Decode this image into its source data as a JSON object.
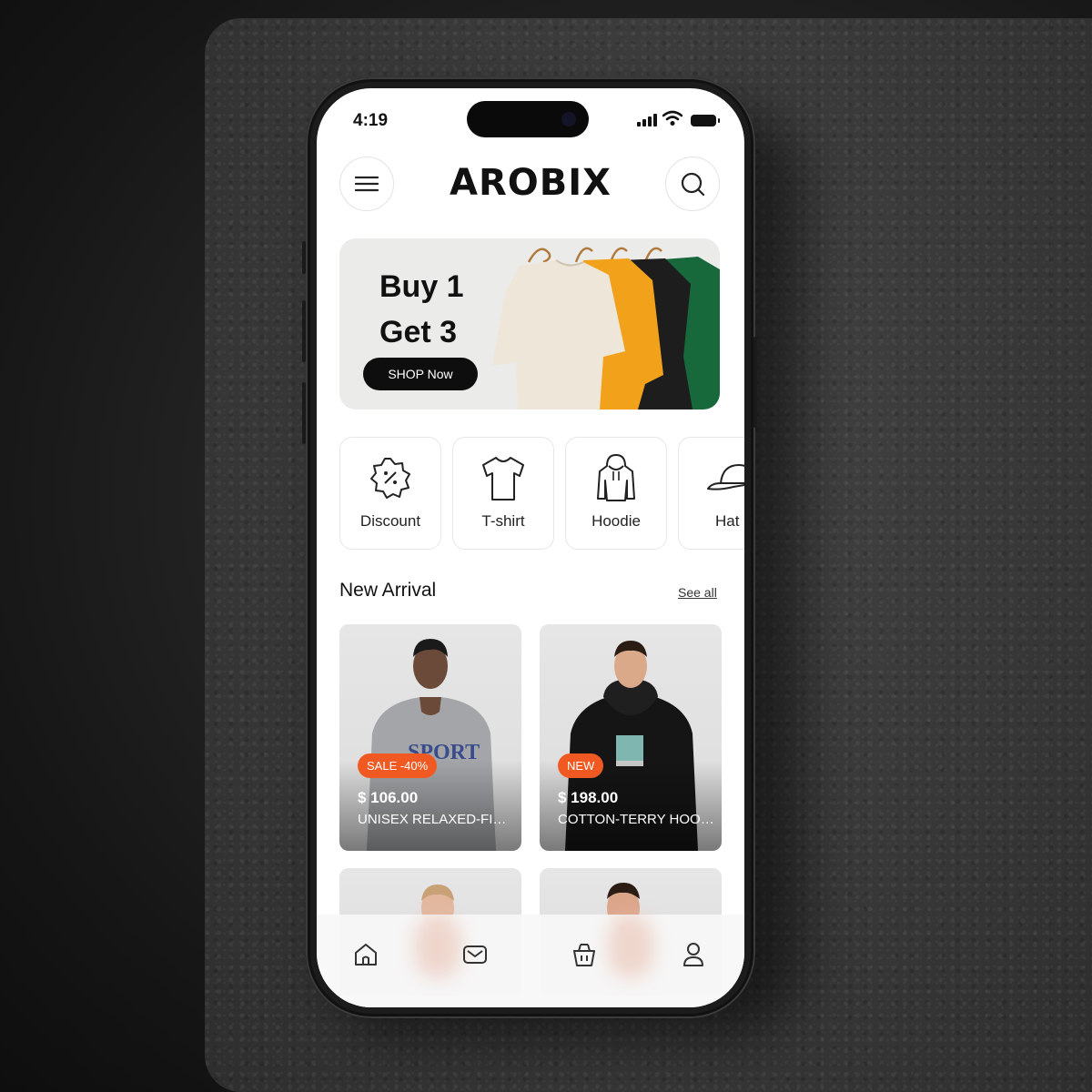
{
  "status_bar": {
    "time": "4:19"
  },
  "header": {
    "brand": "AROBIX",
    "menu_icon": "hamburger-menu-icon",
    "search_icon": "search-icon"
  },
  "banner": {
    "line1": "Buy 1",
    "line2": "Get 3",
    "cta_label": "SHOP Now",
    "shirt_colors": [
      "#efe6da",
      "#f2a21a",
      "#1d1d1d",
      "#17683a"
    ]
  },
  "categories": [
    {
      "label": "Discount",
      "icon": "discount-badge-icon"
    },
    {
      "label": "T-shirt",
      "icon": "tshirt-icon"
    },
    {
      "label": "Hoodie",
      "icon": "hoodie-icon"
    },
    {
      "label": "Hat",
      "icon": "cap-icon"
    }
  ],
  "new_arrival": {
    "title": "New Arrival",
    "see_all": "See all",
    "products": [
      {
        "badge": "SALE -40%",
        "price": "$ 106.00",
        "name": "UNISEX RELAXED-FIT SWEATSHIRT",
        "garment_color": "#a3a5a8"
      },
      {
        "badge": "NEW",
        "price": "$ 198.00",
        "name": "COTTON-TERRY HOODIE",
        "garment_color": "#151515"
      }
    ]
  },
  "tab_bar": [
    {
      "icon": "home-icon"
    },
    {
      "icon": "mail-icon"
    },
    {
      "icon": "shopping-basket-icon"
    },
    {
      "icon": "profile-icon"
    }
  ],
  "colors": {
    "accent": "#f05a22",
    "dark": "#0e0e0e",
    "banner_bg": "#ebebea"
  }
}
